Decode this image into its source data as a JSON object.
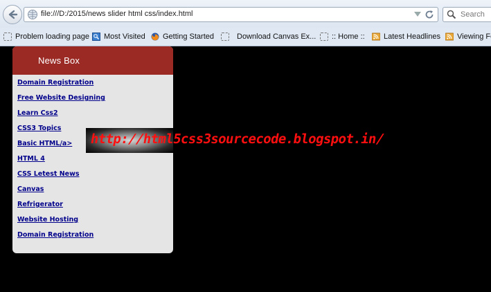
{
  "browser": {
    "url": "file:///D:/2015/news slider html css/index.html",
    "search_placeholder": "Search",
    "bookmarks": [
      {
        "label": "Problem loading page",
        "icon": "blank-page-icon"
      },
      {
        "label": "Most Visited",
        "icon": "most-visited-icon"
      },
      {
        "label": "Getting Started",
        "icon": "firefox-icon"
      },
      {
        "label": "Download Canvas Ex...",
        "icon": "blank-page-icon"
      },
      {
        "label": ":: Home ::",
        "icon": "blank-page-icon"
      },
      {
        "label": "Latest Headlines",
        "icon": "rss-icon"
      },
      {
        "label": "Viewing Fo",
        "icon": "rss-icon"
      }
    ]
  },
  "newsbox": {
    "title": "News Box",
    "items": [
      "Domain Registration",
      "Free Website Designing",
      "Learn Css2",
      "CSS3 Topics",
      "Basic HTML/a>",
      "HTML 4",
      "CSS Letest News",
      "Canvas",
      "Refrigerator",
      "Website Hosting",
      "Domain Registration"
    ],
    "header_color": "#9b2a24",
    "link_color": "#00008b"
  },
  "watermark": {
    "text": "http://html5css3sourcecode.blogspot.in/",
    "color": "#ff0f0f"
  }
}
